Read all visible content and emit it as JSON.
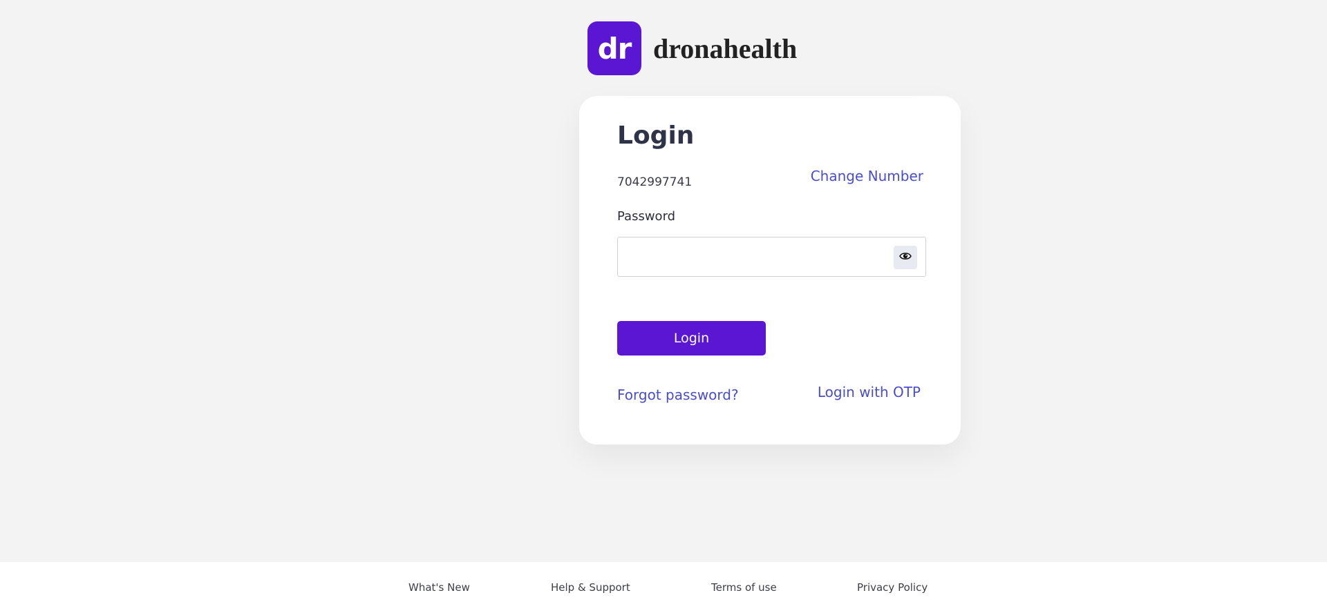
{
  "brand": {
    "logo_text": "dr",
    "name": "dronahealth",
    "accent_color": "#5b16d3"
  },
  "login_card": {
    "title": "Login",
    "phone_number": "7042997741",
    "change_number_link": "Change Number",
    "password_label": "Password",
    "password_value": "",
    "password_placeholder": "",
    "toggle_visibility_icon": "eye-icon",
    "login_button": "Login",
    "forgot_password_link": "Forgot password?",
    "otp_login_link": "Login with OTP",
    "link_color": "#4a4cd0"
  },
  "footer": {
    "links": [
      "What's New",
      "Help & Support",
      "Terms of use",
      "Privacy Policy"
    ]
  }
}
